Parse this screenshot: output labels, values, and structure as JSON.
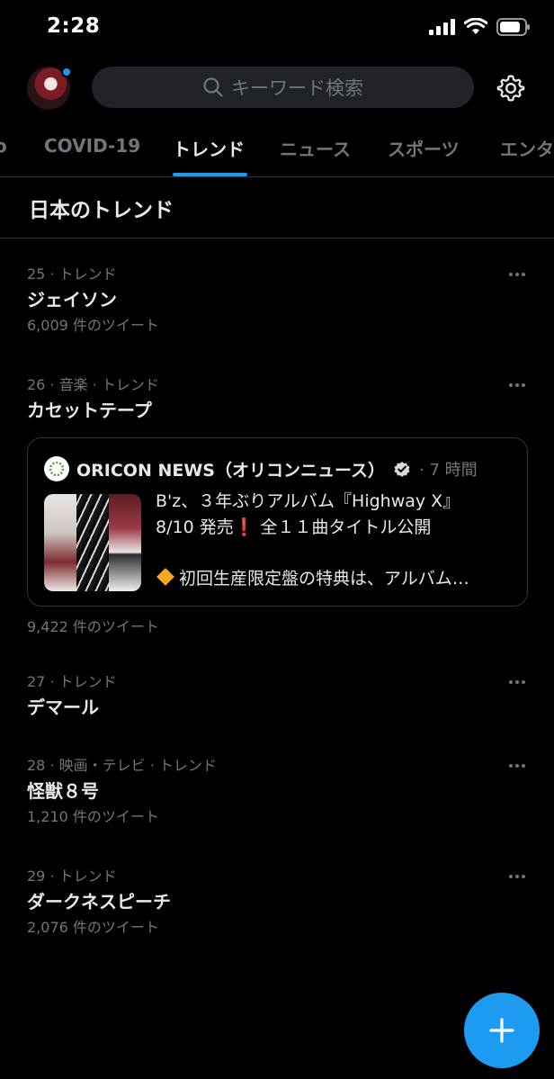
{
  "status_bar": {
    "time": "2:28"
  },
  "header": {
    "search_placeholder": "キーワード検索"
  },
  "tabs": [
    {
      "label": "COVID-19",
      "active": false
    },
    {
      "label": "トレンド",
      "active": true
    },
    {
      "label": "ニュース",
      "active": false
    },
    {
      "label": "スポーツ",
      "active": false
    },
    {
      "label": "エンタ",
      "active": false
    }
  ],
  "section": {
    "title": "日本のトレンド"
  },
  "trends": [
    {
      "meta": "25 · トレンド",
      "name": "ジェイソン",
      "count": "6,009 件のツイート"
    },
    {
      "meta": "26 · 音楽 · トレンド",
      "name": "カセットテープ",
      "count": "9,422 件のツイート"
    },
    {
      "meta": "27 · トレンド",
      "name": "デマール",
      "count": ""
    },
    {
      "meta": "28 · 映画・テレビ · トレンド",
      "name": "怪獣８号",
      "count": "1,210 件のツイート"
    },
    {
      "meta": "29 · トレンド",
      "name": "ダークネスピーチ",
      "count": "2,076 件のツイート"
    }
  ],
  "news_card": {
    "source": "ORICON NEWS（オリコンニュース）",
    "time": "· 7 時間",
    "headline_line1": "B'z、３年ぶりアルバム『Highway X』",
    "headline_line2_a": "8/10 発売",
    "headline_line2_mark": "❗",
    "headline_line2_b": " 全１１曲タイトル公開",
    "snippet": "初回生産限定盤の特典は、アルバム…"
  },
  "colors": {
    "accent": "#1d9bf0",
    "background": "#000000",
    "muted": "#71767b",
    "divider": "#2f3336"
  },
  "icons": [
    "search-icon",
    "gear-icon",
    "verified-icon",
    "more-icon",
    "plus-icon"
  ]
}
